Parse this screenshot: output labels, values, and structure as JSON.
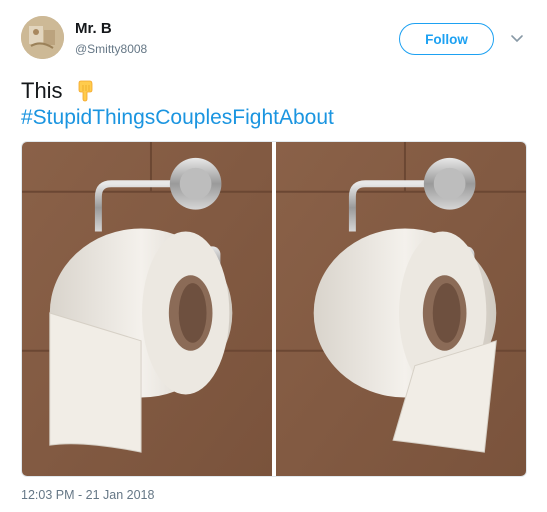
{
  "user": {
    "display_name": "Mr. B",
    "handle": "@Smitty8008",
    "avatar_icon": "avatar-image"
  },
  "actions": {
    "follow_label": "Follow",
    "menu_icon": "chevron-down-icon"
  },
  "tweet": {
    "text": "This",
    "emoji": "pointing-down-emoji",
    "hashtag": "#StupidThingsCouplesFightAbout",
    "timestamp": "12:03 PM - 21 Jan 2018"
  },
  "media": {
    "images": [
      {
        "depicts": "toilet-paper-over"
      },
      {
        "depicts": "toilet-paper-under"
      }
    ]
  },
  "colors": {
    "accent": "#1da1f2",
    "hashtag": "#1b95e0",
    "secondary_text": "#657786"
  }
}
